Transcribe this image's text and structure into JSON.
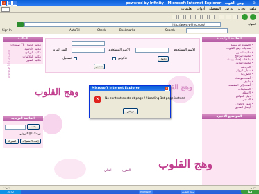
{
  "window": {
    "title": "powered by Infinity - Microsoft Internet Explorer - وهج القوب",
    "minimize": "_",
    "maximize": "□",
    "close": "×"
  },
  "menubar": {
    "items": [
      "ملف",
      "تحرير",
      "عرض",
      "المفضلة",
      "أدوات",
      "تعليمات"
    ]
  },
  "address": {
    "label": "العنوان",
    "url": "http://www.whhrg.com/",
    "go": "انتقال"
  },
  "yahoo": {
    "signin": "Sign In",
    "autofill": "AutoFill",
    "check": "Check",
    "bookmarks": "Bookmarks",
    "search": "Search"
  },
  "site": {
    "right_header": "القائمة الرئيسية",
    "right_items": [
      "الصفحة الرئيسية",
      "منتديات وهج القلوب",
      "مكتبة الصور",
      "مكتبة البرامج",
      "بطاقات إهداء وتهنئة",
      "مكتبة الفلاش",
      "الدردشة",
      "سجل الزوار",
      "اتصل بنا",
      "أضف موقعك",
      "تعارف",
      "أضف إلى المفضلة",
      "المسابقات",
      "الأسئلة",
      "دليل المواقع",
      "المتجر",
      "صور بالجوال",
      "أرسل لصديق"
    ],
    "left_header": "المكتبة",
    "left_items": [
      "مكتبة الجوال 78 صفحات",
      "مكتبة الأناشيد",
      "مكتبة البرامج",
      "مكتبة الفلاشات",
      "مكتبة الصور"
    ],
    "search_box_header": "القائمة البريدية",
    "search_button": "بحث",
    "email_label": "بريدك الإلكتروني",
    "subscribe_button": "اشتراك",
    "unsubscribe_button": "إلغاء الاشتراك",
    "login": {
      "username_label": "الاسم المستخدم",
      "password_label": "كلمة المرور",
      "remember_label": "تذكرني",
      "login_button": "دخول",
      "register_label": "تسجيل"
    },
    "logo": "وهج القلوب",
    "vertical_url": "www.whhrg.com",
    "footer_links": [
      "التالي",
      "المنزل"
    ],
    "bottom_right_header": "المواضيع الأخيرة"
  },
  "dialog": {
    "title": "Microsoft Internet Explorer",
    "message": "No content exists at page !! Loading 1st page instead",
    "ok": "موافق",
    "close": "×"
  },
  "status": {
    "text": "انتهى",
    "zone": "إنترنت"
  },
  "taskbar": {
    "start": "ابدأ",
    "clock": "10:52",
    "items": [
      "وهج القلوب",
      "Microsoft"
    ]
  },
  "colors": {
    "accent": "#b65aa5",
    "link": "#8a1f6f",
    "panel": "#fce4f2",
    "titlebar": "#0a5fd8"
  }
}
